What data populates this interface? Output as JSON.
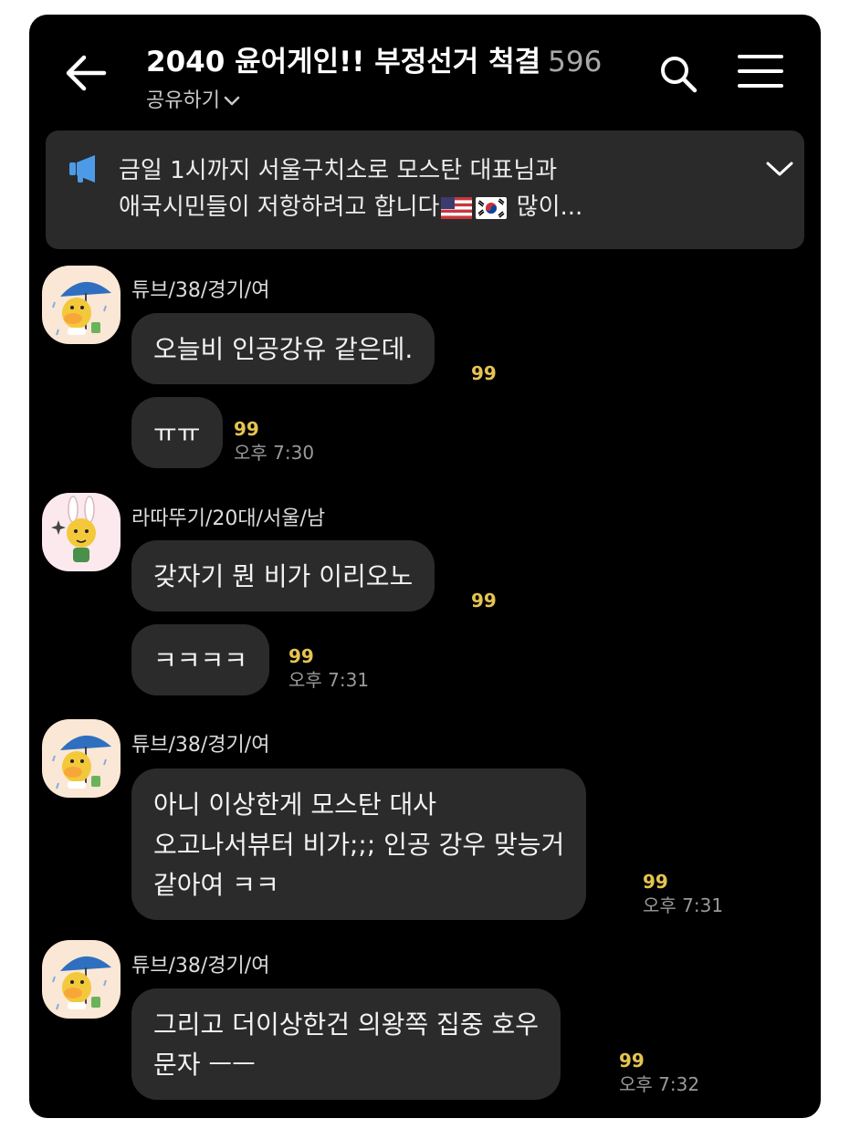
{
  "header": {
    "title": "2040 윤어게인!! 부정선거 척결",
    "member_count": "596",
    "share_label": "공유하기"
  },
  "notice": {
    "line1": "금일 1시까지 서울구치소로 모스탄 대표님과",
    "line2_before_flags": "애국시민들이 저항하려고 합니다",
    "line2_after_flags": " 많이...",
    "flags": [
      "us-flag-icon",
      "kr-flag-icon"
    ]
  },
  "messages": [
    {
      "sender": "튜브/38/경기/여",
      "text": "오늘비 인공강유 같은데.",
      "unread": "99"
    },
    {
      "text": "ㅠㅠ",
      "unread": "99",
      "time": "오후 7:30"
    },
    {
      "sender": "라따뚜기/20대/서울/남",
      "text": "갖자기 뭔 비가 이리오노",
      "unread": "99"
    },
    {
      "text": "ㅋㅋㅋㅋ",
      "unread": "99",
      "time": "오후 7:31"
    },
    {
      "sender": "튜브/38/경기/여",
      "lines": [
        "아니 이상한게 모스탄 대사",
        "오고나서뷰터 비가;;; 인공 강우 맞능거",
        "같아여 ㅋㅋ"
      ],
      "unread": "99",
      "time": "오후 7:31"
    },
    {
      "sender": "튜브/38/경기/여",
      "lines": [
        "그리고 더이상한건 의왕쪽 집중 호우",
        "문자 ㅡㅡ"
      ],
      "unread": "99",
      "time": "오후 7:32"
    }
  ],
  "colors": {
    "background": "#000000",
    "bubble": "#2b2b2b",
    "notice": "#2a2a2a",
    "unread": "#e6c451",
    "time": "#9a9a9a"
  }
}
